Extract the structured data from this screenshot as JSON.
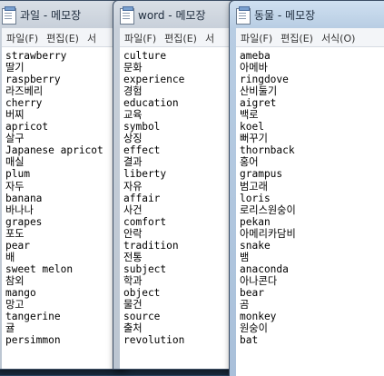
{
  "menu": {
    "file": "파일(F)",
    "edit": "편집(E)",
    "format_partial": "서",
    "format_full": "서식(O)"
  },
  "windows": [
    {
      "title": "과일 - 메모장",
      "lines": [
        "strawberry",
        "딸기",
        "raspberry",
        "라즈베리",
        "cherry",
        "버찌",
        "apricot",
        "살구",
        "Japanese apricot",
        "매실",
        "plum",
        "자두",
        "banana",
        "바나나",
        "grapes",
        "포도",
        "pear",
        "배",
        "sweet melon",
        "참외",
        "mango",
        "망고",
        "tangerine",
        "귤",
        "persimmon"
      ]
    },
    {
      "title": "word - 메모장",
      "lines": [
        "culture",
        "문화",
        "experience",
        "경험",
        "education",
        "교육",
        "symbol",
        "상징",
        "effect",
        "결과",
        "liberty",
        "자유",
        "affair",
        "사건",
        "comfort",
        "안락",
        "tradition",
        "전통",
        "subject",
        "학과",
        "object",
        "물건",
        "source",
        "출처",
        "revolution"
      ]
    },
    {
      "title": "동물 - 메모장",
      "lines": [
        "ameba",
        "아메바",
        "ringdove",
        "산비둘기",
        "aigret",
        "백로",
        "koel",
        "뻐꾸기",
        "thornback",
        "홍어",
        "grampus",
        "범고래",
        "loris",
        "로리스원숭이",
        "pekan",
        "아메리카담비",
        "snake",
        "뱀",
        "anaconda",
        "아나콘다",
        "bear",
        "곰",
        "monkey",
        "원숭이",
        "bat"
      ]
    }
  ]
}
